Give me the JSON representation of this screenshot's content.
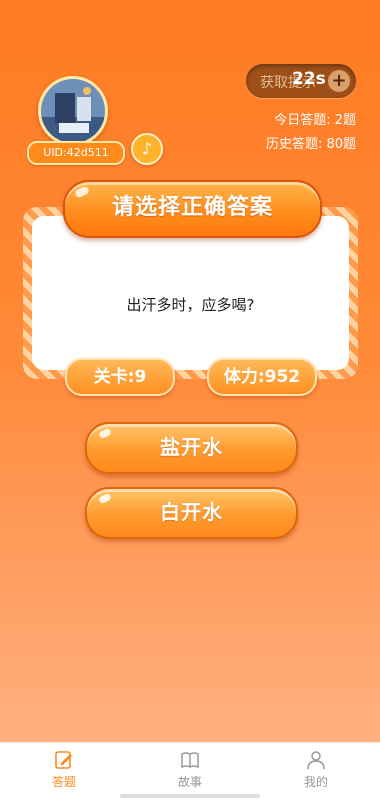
{
  "header": {
    "uid_label": "UID:42d511",
    "music_icon": "music-note-icon",
    "hint_label": "获取提示",
    "timer": "22s",
    "plus_icon": "plus-icon",
    "today_label": "今日答题: 2题",
    "history_label": "历史答题: 80题"
  },
  "quiz": {
    "banner": "请选择正确答案",
    "question": "出汗多时，应多喝?",
    "level_label": "关卡:9",
    "stamina_label": "体力:952",
    "answers": [
      {
        "label": "盐开水"
      },
      {
        "label": "白开水"
      }
    ]
  },
  "tabbar": {
    "items": [
      {
        "label": "答题",
        "icon": "pencil-note-icon",
        "active": true
      },
      {
        "label": "故事",
        "icon": "book-icon",
        "active": false
      },
      {
        "label": "我的",
        "icon": "person-icon",
        "active": false
      }
    ]
  },
  "colors": {
    "accent": "#ff8a1c",
    "background_top": "#ff7a22",
    "background_bottom": "#ffb07e"
  }
}
